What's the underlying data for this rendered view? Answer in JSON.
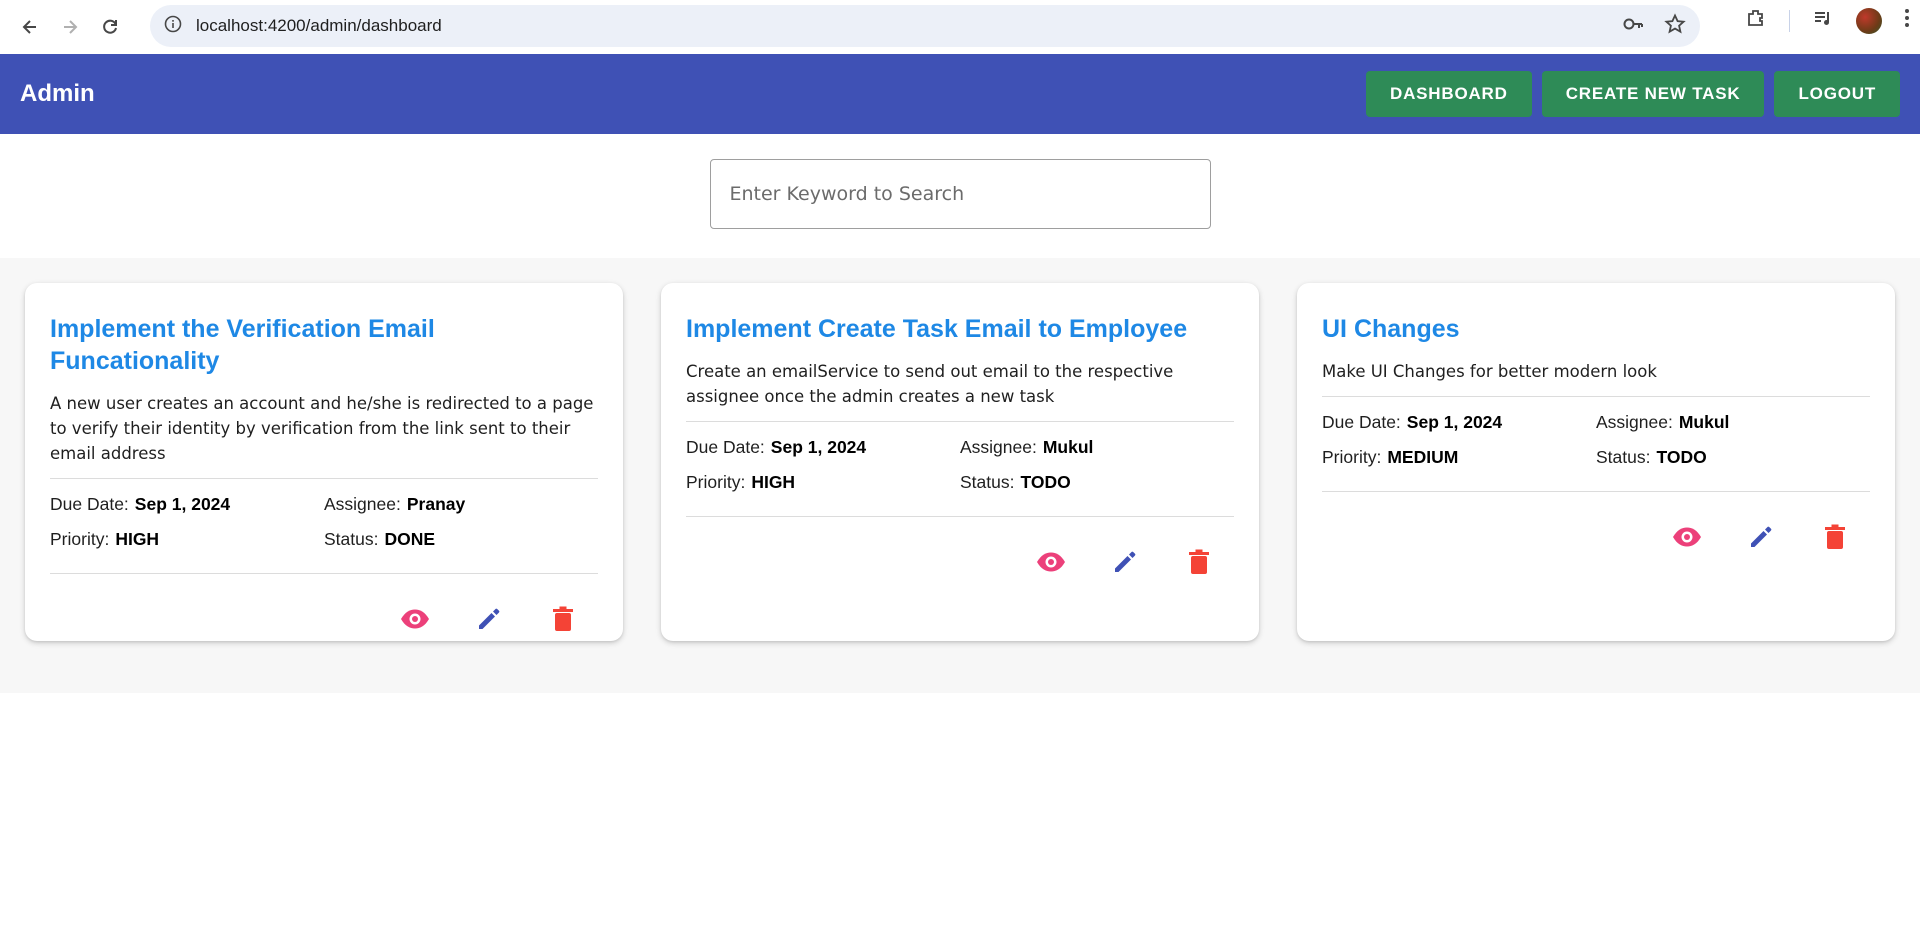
{
  "browser": {
    "url": "localhost:4200/admin/dashboard",
    "icons": [
      "back-icon",
      "forward-icon",
      "reload-icon",
      "site-info-icon",
      "key-icon",
      "star-icon",
      "extensions-icon",
      "media-icon",
      "profile-avatar",
      "menu-icon"
    ]
  },
  "header": {
    "brand": "Admin",
    "buttons": [
      "DASHBOARD",
      "CREATE NEW TASK",
      "LOGOUT"
    ],
    "colors": {
      "bar": "#3f51b5",
      "button": "#2e8b57"
    }
  },
  "search": {
    "placeholder": "Enter Keyword to Search"
  },
  "labels": {
    "due": "Due Date:",
    "assignee": "Assignee:",
    "priority": "Priority:",
    "status": "Status:"
  },
  "tasks": [
    {
      "title": "Implement the Verification Email Funcationality",
      "description": "A new user creates an account and he/she is redirected to a page to verify their identity by verification from the link sent to their email address",
      "due": "Sep 1, 2024",
      "assignee": "Pranay",
      "priority": "HIGH",
      "status": "DONE"
    },
    {
      "title": "Implement Create Task Email to Employee",
      "description": "Create an emailService to send out email to the respective assignee once the admin creates a new task",
      "due": "Sep 1, 2024",
      "assignee": "Mukul",
      "priority": "HIGH",
      "status": "TODO"
    },
    {
      "title": "UI Changes",
      "description": "Make UI Changes for better modern look",
      "due": "Sep 1, 2024",
      "assignee": "Mukul",
      "priority": "MEDIUM",
      "status": "TODO"
    }
  ],
  "action_colors": {
    "view": "#ec407a",
    "edit": "#3f51b5",
    "delete": "#f44336"
  },
  "title_color": "#1e88e5"
}
